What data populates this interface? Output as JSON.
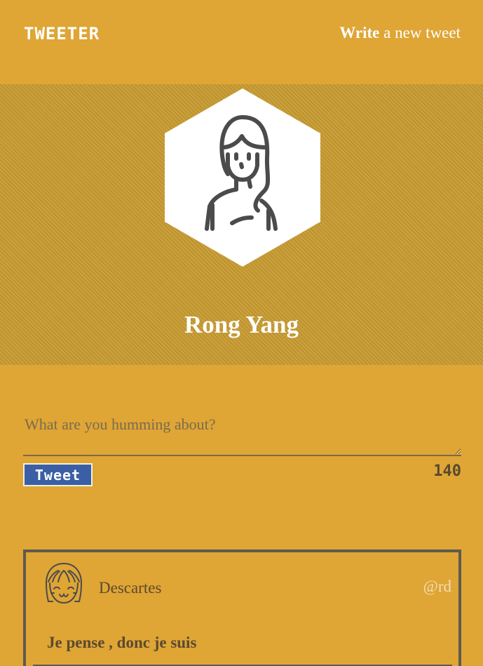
{
  "header": {
    "logo": "Tweeter",
    "write_bold": "Write",
    "write_rest": " a new tweet"
  },
  "profile": {
    "name": "Rong Yang",
    "avatar_icon": "woman-avatar-icon"
  },
  "composer": {
    "placeholder": "What are you humming about?",
    "value": "",
    "button_label": "Tweet",
    "char_count": "140"
  },
  "tweets": [
    {
      "author": "Descartes",
      "handle": "@rd",
      "text": "Je pense , donc je suis",
      "avatar_icon": "smiling-face-avatar-icon"
    }
  ],
  "colors": {
    "background": "#dfa535",
    "banner": "#c99b2e",
    "button": "#3b5fa5",
    "text_dark": "#5a4a30"
  }
}
